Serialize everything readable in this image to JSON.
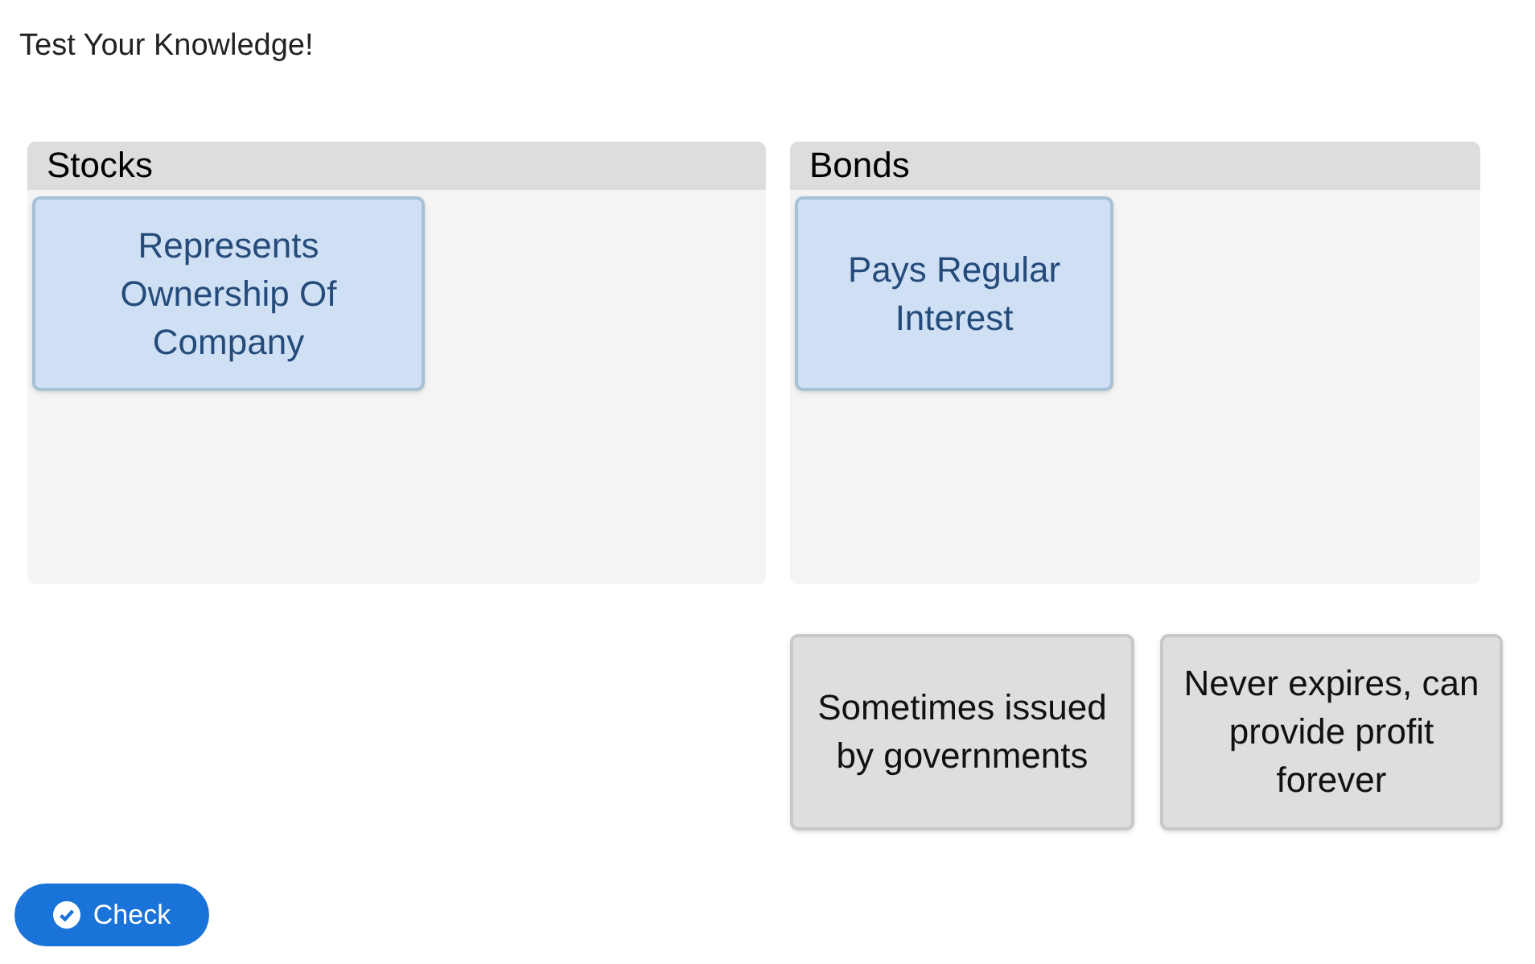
{
  "title": "Test Your Knowledge!",
  "categories": [
    {
      "name": "Stocks",
      "items": [
        {
          "text": "Represents Ownership Of Company"
        }
      ]
    },
    {
      "name": "Bonds",
      "items": [
        {
          "text": "Pays Regular Interest"
        }
      ]
    }
  ],
  "pool": [
    {
      "text": "Sometimes issued by governments"
    },
    {
      "text": "Never expires, can provide profit forever"
    }
  ],
  "check_button": {
    "label": "Check"
  }
}
